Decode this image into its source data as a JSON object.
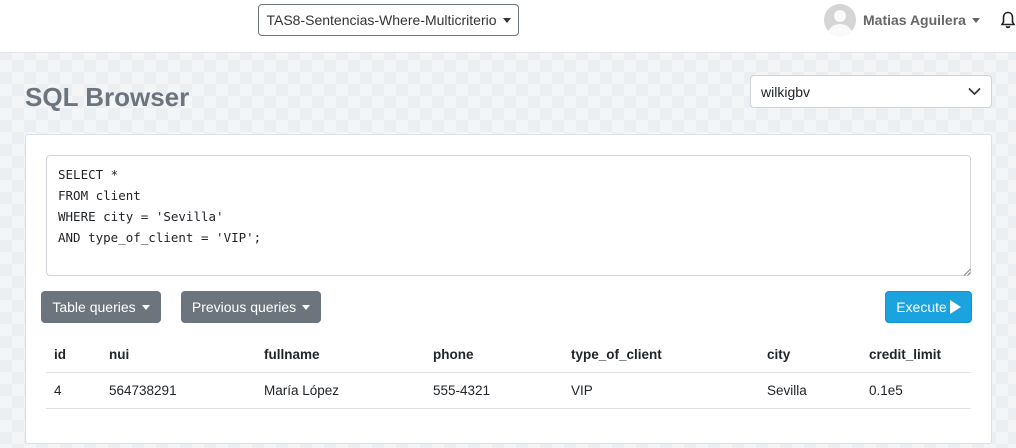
{
  "header": {
    "course_select": "TAS8-Sentencias-Where-Multicriterio",
    "user_name": "Matias Aguilera"
  },
  "page": {
    "title": "SQL Browser",
    "database_select": "wilkigbv"
  },
  "editor": {
    "query": "SELECT *\nFROM client\nWHERE city = 'Sevilla'\nAND type_of_client = 'VIP';"
  },
  "toolbar": {
    "table_queries_label": "Table queries",
    "previous_queries_label": "Previous queries",
    "execute_label": "Execute"
  },
  "results": {
    "columns": [
      "id",
      "nui",
      "fullname",
      "phone",
      "type_of_client",
      "city",
      "credit_limit"
    ],
    "rows": [
      [
        "4",
        "564738291",
        "María López",
        "555-4321",
        "VIP",
        "Sevilla",
        "0.1e5"
      ]
    ]
  },
  "colors": {
    "execute_button": "#1aa3df",
    "secondary_button": "#6c757d",
    "title": "#6c757d"
  }
}
